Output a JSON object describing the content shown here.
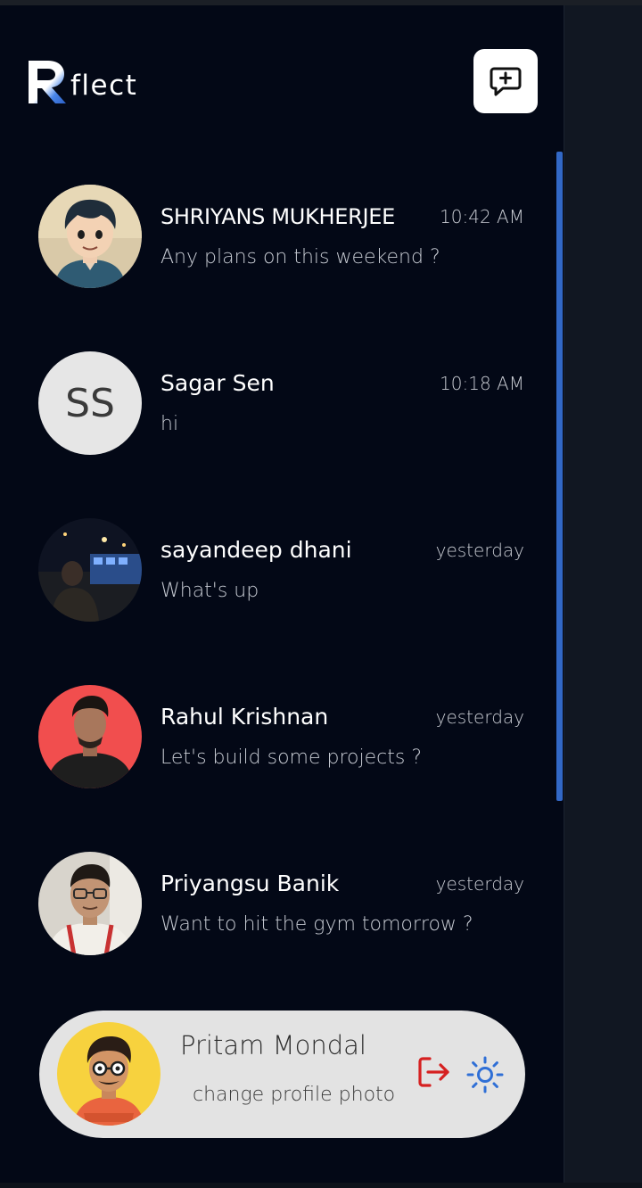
{
  "app": {
    "logo_text": "flect",
    "logo_letter": "R"
  },
  "header": {
    "new_chat_icon": "new-message-icon"
  },
  "chats": [
    {
      "name": "SHRIYANS MUKHERJEE",
      "time": "10:42 AM",
      "preview": "Any plans on this weekend ?",
      "avatar": "photo"
    },
    {
      "name": "Sagar Sen",
      "time": "10:18 AM",
      "preview": "hi",
      "avatar": "initials",
      "initials": "SS"
    },
    {
      "name": "sayandeep dhani",
      "time": "yesterday",
      "preview": "What's up",
      "avatar": "photo"
    },
    {
      "name": "Rahul Krishnan",
      "time": "yesterday",
      "preview": "Let's build some projects ?",
      "avatar": "photo"
    },
    {
      "name": "Priyangsu Banik",
      "time": "yesterday",
      "preview": "Want to hit the gym tomorrow ?",
      "avatar": "photo"
    }
  ],
  "profile": {
    "name": "Pritam Mondal",
    "change_photo_label": "change profile photo",
    "logout_icon": "logout-icon",
    "settings_icon": "settings-sun-icon"
  },
  "colors": {
    "background": "#030816",
    "scrollbar": "#3268c6",
    "logout": "#d62020",
    "settings": "#2f6fd6",
    "profile_card": "#e3e3e3"
  }
}
